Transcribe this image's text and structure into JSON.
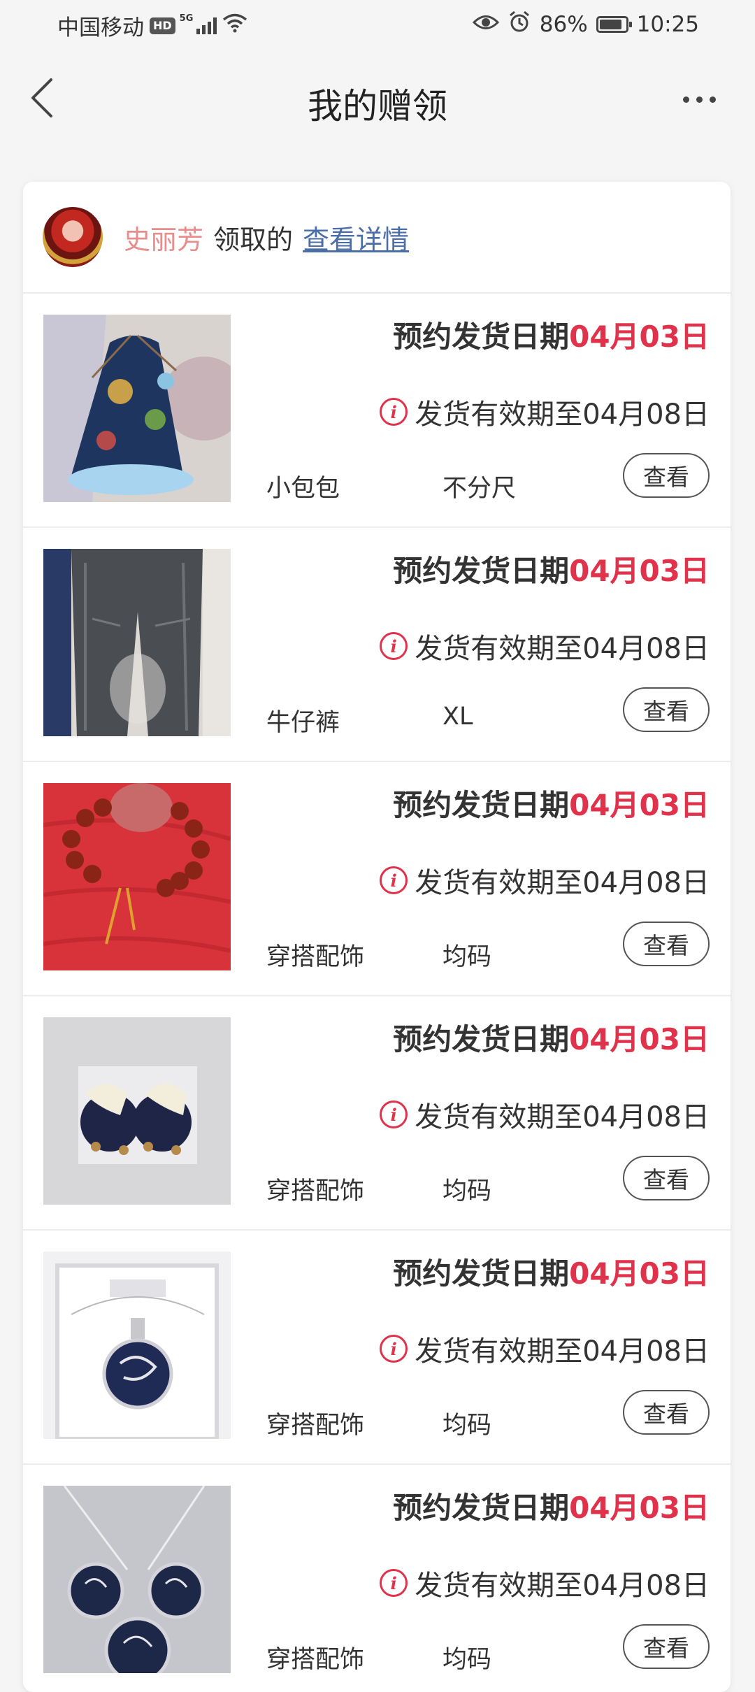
{
  "status_bar": {
    "carrier": "中国移动",
    "hd": "HD",
    "network": "5G",
    "battery_percent": "86%",
    "battery_level": 0.86,
    "time": "10:25"
  },
  "nav": {
    "title": "我的赠领",
    "back_icon": "chevron-left-icon",
    "more_icon": "more-horizontal-icon"
  },
  "header": {
    "receiver_name": "史丽芳",
    "received_text": "领取的",
    "detail_link": "查看详情"
  },
  "colors": {
    "accent_red": "#e0324b",
    "name_pink": "#e88c8c",
    "link_blue": "#4a6ea8"
  },
  "items": [
    {
      "ship_label": "预约发货日期",
      "ship_date": "04月03日",
      "validity": "发货有效期至04月08日",
      "name": "小包包",
      "size": "不分尺",
      "button": "查看"
    },
    {
      "ship_label": "预约发货日期",
      "ship_date": "04月03日",
      "validity": "发货有效期至04月08日",
      "name": "牛仔裤",
      "size": "XL",
      "button": "查看"
    },
    {
      "ship_label": "预约发货日期",
      "ship_date": "04月03日",
      "validity": "发货有效期至04月08日",
      "name": "穿搭配饰",
      "size": "均码",
      "button": "查看"
    },
    {
      "ship_label": "预约发货日期",
      "ship_date": "04月03日",
      "validity": "发货有效期至04月08日",
      "name": "穿搭配饰",
      "size": "均码",
      "button": "查看"
    },
    {
      "ship_label": "预约发货日期",
      "ship_date": "04月03日",
      "validity": "发货有效期至04月08日",
      "name": "穿搭配饰",
      "size": "均码",
      "button": "查看"
    },
    {
      "ship_label": "预约发货日期",
      "ship_date": "04月03日",
      "validity": "发货有效期至04月08日",
      "name": "穿搭配饰",
      "size": "均码",
      "button": "查看"
    }
  ]
}
